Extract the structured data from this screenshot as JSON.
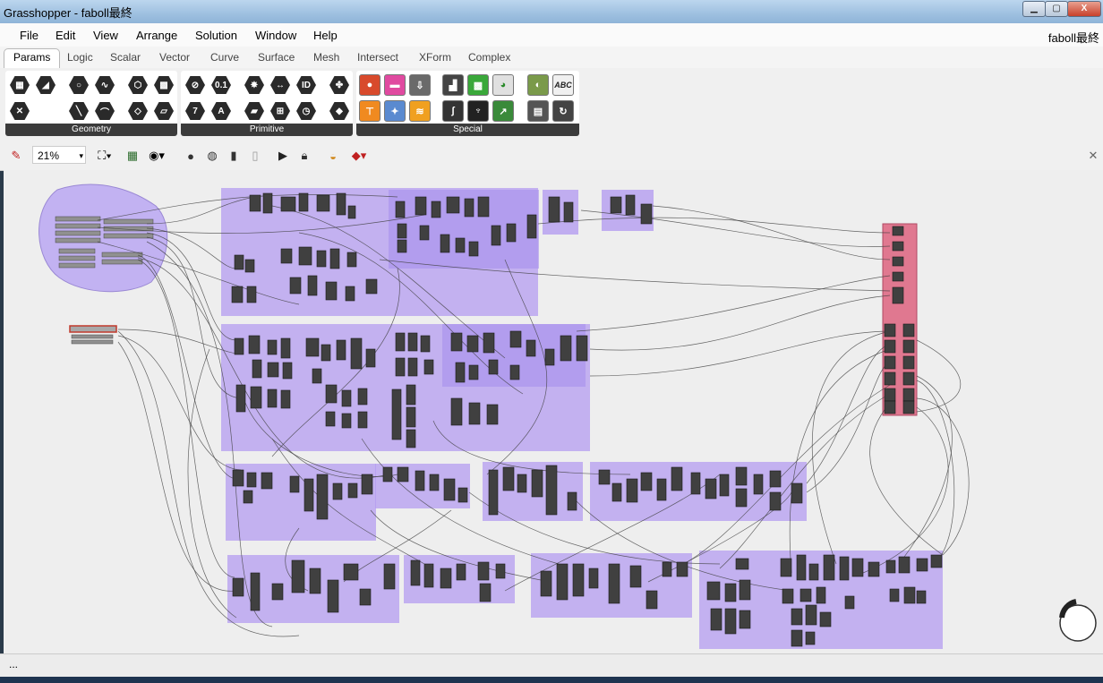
{
  "window": {
    "title": "Grasshopper - faboll最終",
    "btn_min": "▁",
    "btn_max": "▢",
    "btn_close": "X"
  },
  "menu": {
    "items": [
      "File",
      "Edit",
      "View",
      "Arrange",
      "Solution",
      "Window",
      "Help"
    ],
    "doc_name": "faboll最終"
  },
  "tabs": [
    "Params",
    "Logic",
    "Scalar",
    "Vector",
    "Curve",
    "Surface",
    "Mesh",
    "Intersect",
    "XForm",
    "Complex"
  ],
  "ribbon": {
    "panels": [
      "Geometry",
      "Primitive",
      "Special"
    ]
  },
  "canvas_toolbar": {
    "zoom": "21%"
  },
  "status": {
    "text": "..."
  },
  "colors": {
    "group_fill": "#b49cf0",
    "cluster_fill": "#e07890",
    "input_blob": "#c2b2f2",
    "component": "#404040"
  }
}
